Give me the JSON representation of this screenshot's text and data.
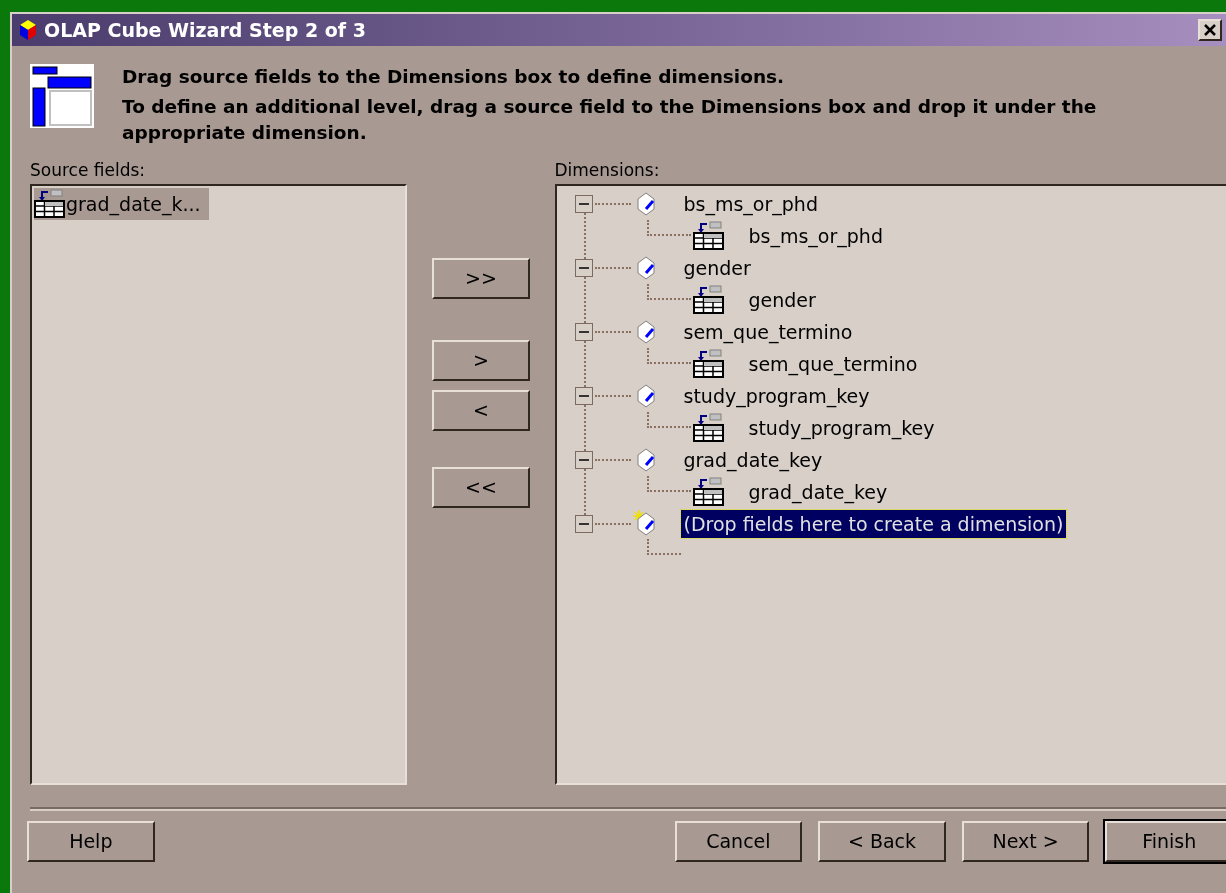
{
  "window": {
    "title": "OLAP Cube Wizard Step 2 of 3"
  },
  "instructions": [
    "Drag source fields to the Dimensions box to define dimensions.",
    "To define an additional level, drag a source field to the Dimensions box and drop it under the appropriate dimension."
  ],
  "source_fields": {
    "label": "Source fields:",
    "items": [
      {
        "name": "grad_date_k...",
        "selected": true
      }
    ]
  },
  "move_buttons": [
    ">>",
    ">",
    "<",
    "<<"
  ],
  "dimensions": {
    "label": "Dimensions:",
    "items": [
      {
        "kind": "existing",
        "name": "bs_ms_or_phd",
        "selected": false,
        "expanded": true,
        "children": [
          {
            "name": "bs_ms_or_phd"
          }
        ]
      },
      {
        "kind": "existing",
        "name": "gender",
        "selected": false,
        "expanded": true,
        "children": [
          {
            "name": "gender"
          }
        ]
      },
      {
        "kind": "existing",
        "name": "sem_que_termino",
        "selected": false,
        "expanded": true,
        "children": [
          {
            "name": "sem_que_termino"
          }
        ]
      },
      {
        "kind": "existing",
        "name": "study_program_key",
        "selected": false,
        "expanded": true,
        "children": [
          {
            "name": "study_program_key"
          }
        ]
      },
      {
        "kind": "existing",
        "name": "grad_date_key",
        "selected": false,
        "expanded": true,
        "children": [
          {
            "name": "grad_date_key"
          }
        ]
      },
      {
        "kind": "new",
        "name": "(Drop fields here to create a dimension)",
        "selected": true,
        "expanded": true
      }
    ]
  },
  "buttons": [
    {
      "label": "Help",
      "default": false
    },
    {
      "label": "Cancel",
      "default": false
    },
    {
      "label": "< Back",
      "default": false
    },
    {
      "label": "Next >",
      "default": false
    },
    {
      "label": "Finish",
      "default": true
    }
  ]
}
